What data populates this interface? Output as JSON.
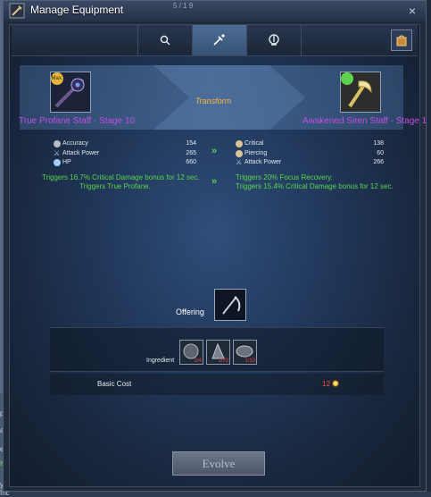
{
  "window": {
    "title": "Manage Equipment",
    "title_faint_text": "5 / 1 9",
    "close_symbol": "×"
  },
  "tabs": [
    {
      "icon": "search-icon",
      "active": false
    },
    {
      "icon": "transform-icon",
      "active": true
    },
    {
      "icon": "evolve-icon",
      "active": false
    }
  ],
  "transform": {
    "label": "Transform",
    "source": {
      "name": "True Profane Staff - Stage 10",
      "badge": "Max."
    },
    "target": {
      "name": "Awakened Siren Staff - Stage 1"
    }
  },
  "stats": {
    "source": [
      {
        "name": "Accuracy",
        "value": "154",
        "icon": "accuracy-icon"
      },
      {
        "name": "Attack Power",
        "value": "265",
        "icon": "attack-power-icon"
      },
      {
        "name": "HP",
        "value": "660",
        "icon": "hp-icon"
      }
    ],
    "target": [
      {
        "name": "Critical",
        "value": "138",
        "icon": "critical-icon"
      },
      {
        "name": "Piercing",
        "value": "60",
        "icon": "piercing-icon"
      },
      {
        "name": "Attack Power",
        "value": "266",
        "icon": "attack-power-icon"
      }
    ],
    "arrow": "»"
  },
  "effects": {
    "source": "Triggers 16.7% Critical Damage bonus for 12 sec.\n                   Triggers True Profane.",
    "target": "Triggers 20% Focus Recovery.\nTriggers 15.4% Critical Damage bonus for 12 sec."
  },
  "offering": {
    "label": "Offering"
  },
  "ingredients": {
    "label": "Ingredient",
    "items": [
      {
        "count": "0/4"
      },
      {
        "count": "1/70"
      },
      {
        "count": "1/10"
      }
    ]
  },
  "cost": {
    "label": "Basic Cost",
    "value": "12"
  },
  "evolve_button": "Evolve",
  "side_fragments": [
    "pa",
    "Ki",
    "a",
    "e",
    "y Inc"
  ],
  "colors": {
    "item_name": "#c24ee0",
    "effect_text": "#58d64a",
    "transform_label": "#ffb53a",
    "insufficient": "#e24545"
  }
}
